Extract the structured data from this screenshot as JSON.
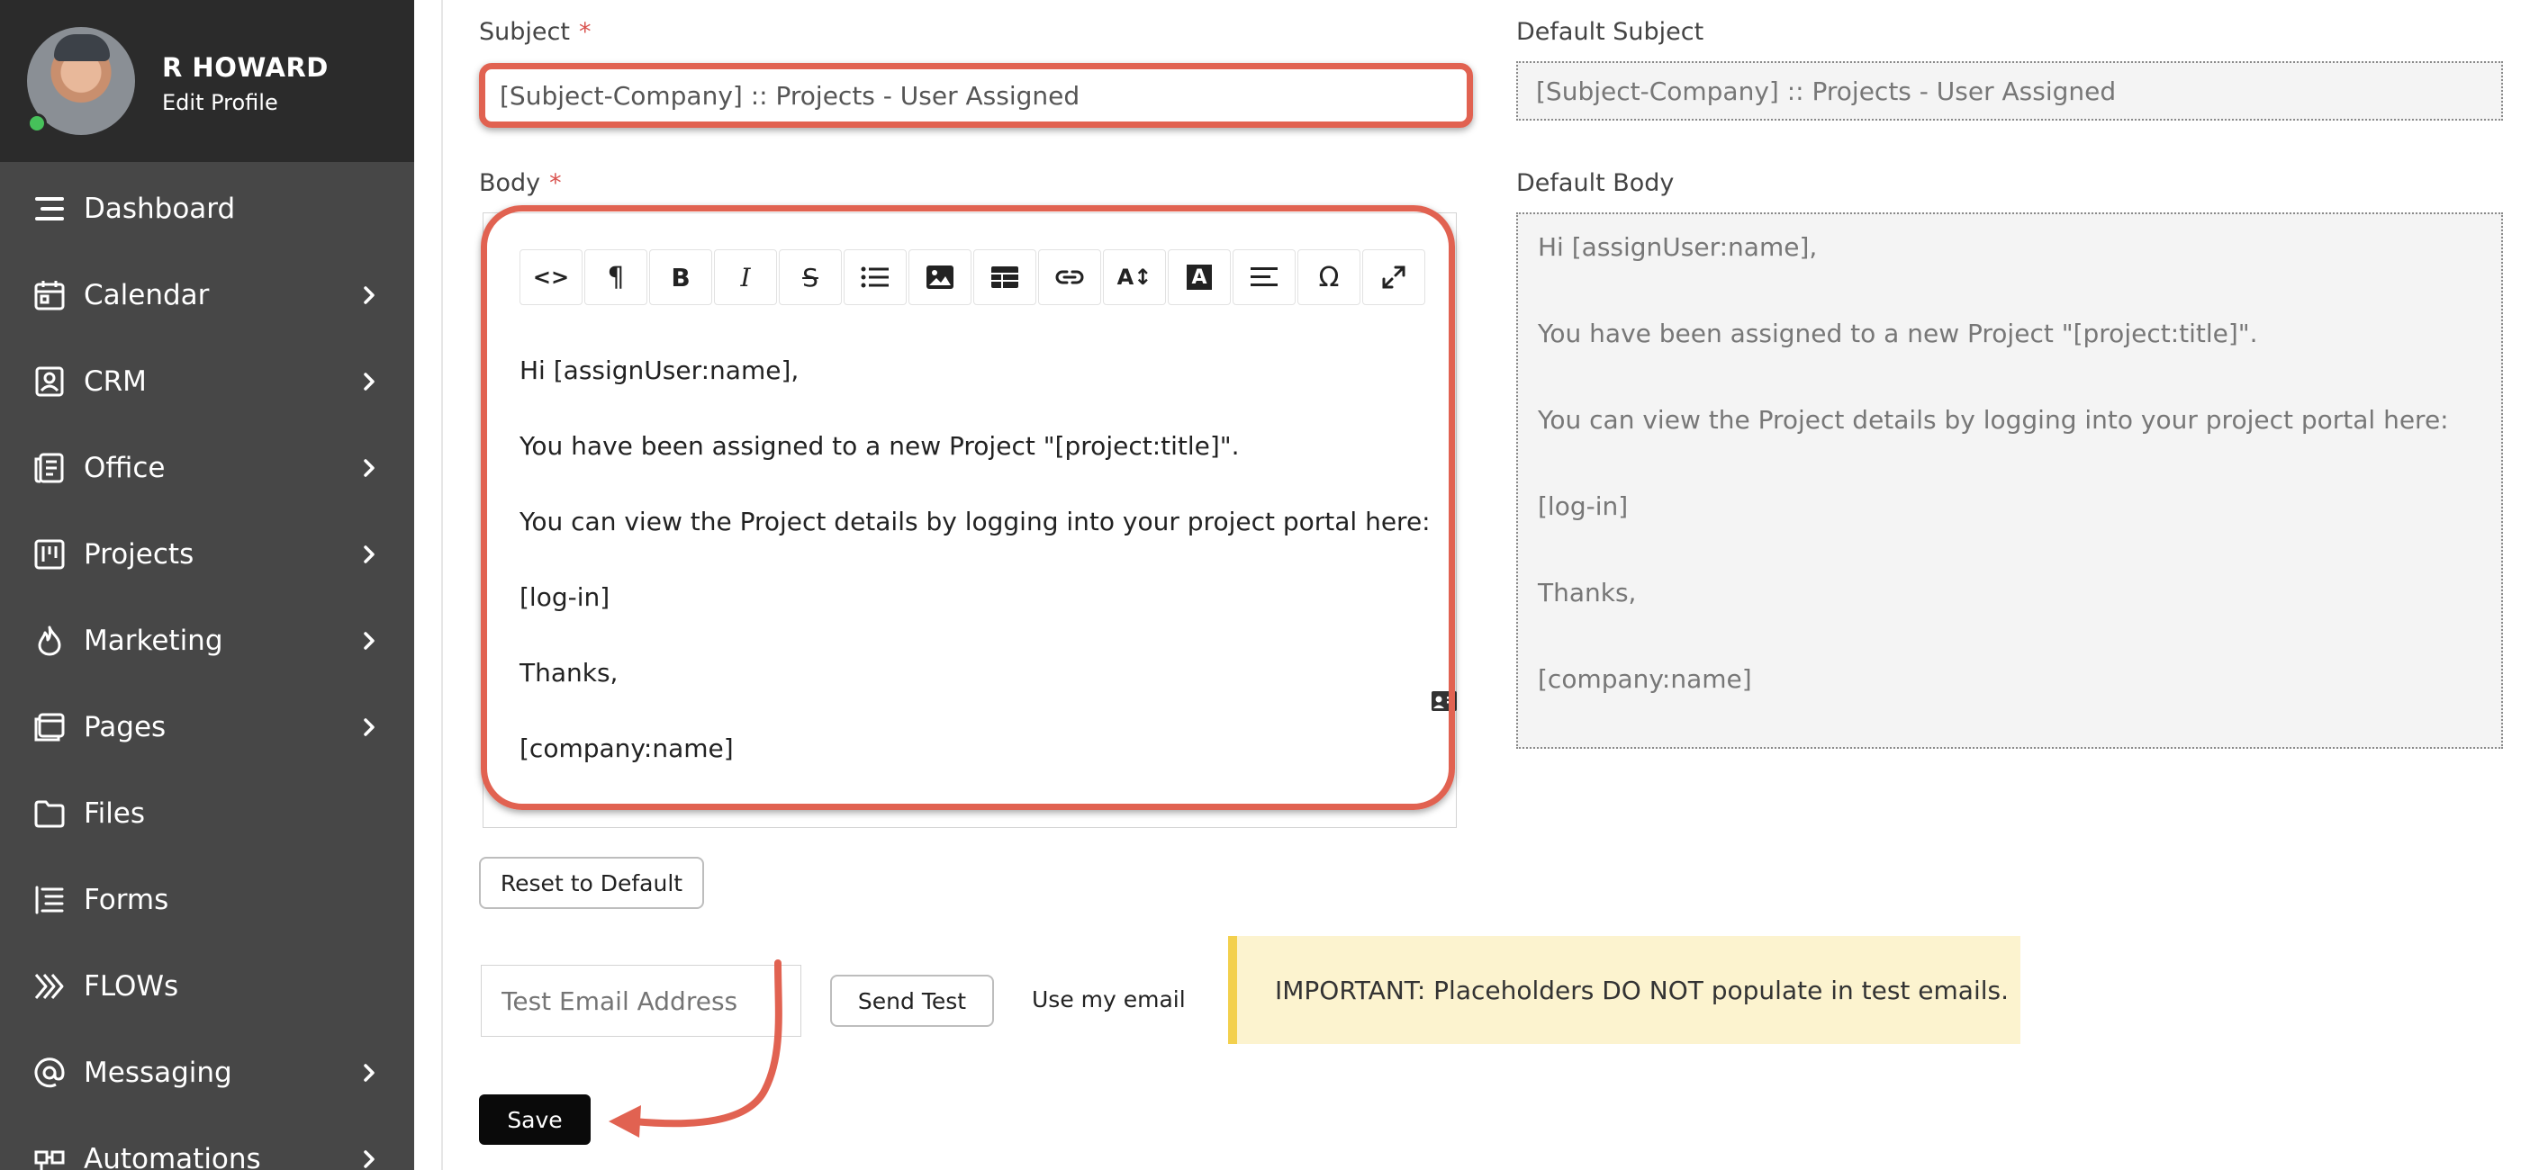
{
  "profile": {
    "name": "R HOWARD",
    "edit_label": "Edit Profile"
  },
  "sidebar": {
    "items": [
      {
        "label": "Dashboard",
        "icon": "menu-lines-icon",
        "has_children": false
      },
      {
        "label": "Calendar",
        "icon": "calendar-icon",
        "has_children": true
      },
      {
        "label": "CRM",
        "icon": "contact-card-icon",
        "has_children": true
      },
      {
        "label": "Office",
        "icon": "office-document-icon",
        "has_children": true
      },
      {
        "label": "Projects",
        "icon": "kanban-board-icon",
        "has_children": true
      },
      {
        "label": "Marketing",
        "icon": "flame-icon",
        "has_children": true
      },
      {
        "label": "Pages",
        "icon": "browser-pages-icon",
        "has_children": true
      },
      {
        "label": "Files",
        "icon": "folder-icon",
        "has_children": false
      },
      {
        "label": "Forms",
        "icon": "form-list-icon",
        "has_children": false
      },
      {
        "label": "FLOWs",
        "icon": "flow-chevrons-icon",
        "has_children": false
      },
      {
        "label": "Messaging",
        "icon": "at-sign-icon",
        "has_children": true
      },
      {
        "label": "Automations",
        "icon": "automation-icon",
        "has_children": true
      }
    ]
  },
  "form": {
    "subject_label": "Subject",
    "subject_value": "[Subject-Company] :: Projects - User Assigned",
    "default_subject_label": "Default Subject",
    "default_subject_value": "[Subject-Company] :: Projects - User Assigned",
    "body_label": "Body",
    "default_body_label": "Default Body",
    "required_marker": "*",
    "body_lines": [
      "Hi [assignUser:name],",
      "You have been assigned to a new Project \"[project:title]\".",
      "You can view the Project details by logging into your project portal here:",
      "[log-in]",
      "Thanks,",
      "[company:name]"
    ],
    "default_body_lines": [
      "Hi [assignUser:name],",
      "You have been assigned to a new Project \"[project:title]\".",
      "You can view the Project details by logging into your project portal here:",
      "[log-in]",
      "Thanks,",
      "[company:name]"
    ],
    "toolbar": [
      {
        "name": "code-view-icon",
        "glyph": "<>"
      },
      {
        "name": "paragraph-icon",
        "glyph": "¶"
      },
      {
        "name": "bold-icon",
        "glyph": "B"
      },
      {
        "name": "italic-icon",
        "glyph": "I"
      },
      {
        "name": "strikethrough-icon",
        "glyph": "S"
      },
      {
        "name": "bullet-list-icon",
        "glyph": ""
      },
      {
        "name": "image-icon",
        "glyph": ""
      },
      {
        "name": "table-icon",
        "glyph": ""
      },
      {
        "name": "link-icon",
        "glyph": ""
      },
      {
        "name": "font-size-icon",
        "glyph": "A↕"
      },
      {
        "name": "text-color-icon",
        "glyph": "A"
      },
      {
        "name": "align-icon",
        "glyph": ""
      },
      {
        "name": "special-char-icon",
        "glyph": "Ω"
      },
      {
        "name": "fullscreen-icon",
        "glyph": ""
      }
    ],
    "reset_label": "Reset to Default",
    "test_email_placeholder": "Test Email Address",
    "send_test_label": "Send Test",
    "use_my_email_label": "Use my email",
    "notice_text": "IMPORTANT: Placeholders DO NOT populate in test emails.",
    "save_label": "Save"
  },
  "colors": {
    "sidebar_bg": "#474747",
    "profile_bg": "#2b2b2b",
    "annotation": "#e16251",
    "notice_bg": "#fcf3cf",
    "notice_border": "#f3d04d",
    "save_bg": "#0a0a0a"
  }
}
